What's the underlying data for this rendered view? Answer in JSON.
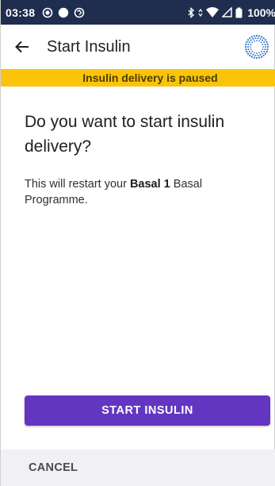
{
  "status_bar": {
    "time": "03:38",
    "left_icons": [
      "record-icon",
      "dot-icon",
      "sync-icon"
    ],
    "right_icons": [
      "bluetooth-icon",
      "signal-arrows-icon",
      "wifi-icon",
      "cell-signal-icon",
      "battery-icon"
    ],
    "battery": "100%",
    "background": "#1f2d4e"
  },
  "app_bar": {
    "title": "Start Insulin",
    "back_icon": "back-arrow-icon",
    "logo_icon": "dotted-circle-logo-icon"
  },
  "banner": {
    "text": "Insulin delivery is paused",
    "color": "#fbc40a"
  },
  "content": {
    "heading": "Do you want to start insulin delivery?",
    "desc_prefix": "This will restart your ",
    "desc_bold": "Basal 1",
    "desc_suffix": " Basal Programme."
  },
  "actions": {
    "primary_label": "START INSULIN",
    "primary_color": "#6236c0",
    "secondary_label": "CANCEL"
  }
}
